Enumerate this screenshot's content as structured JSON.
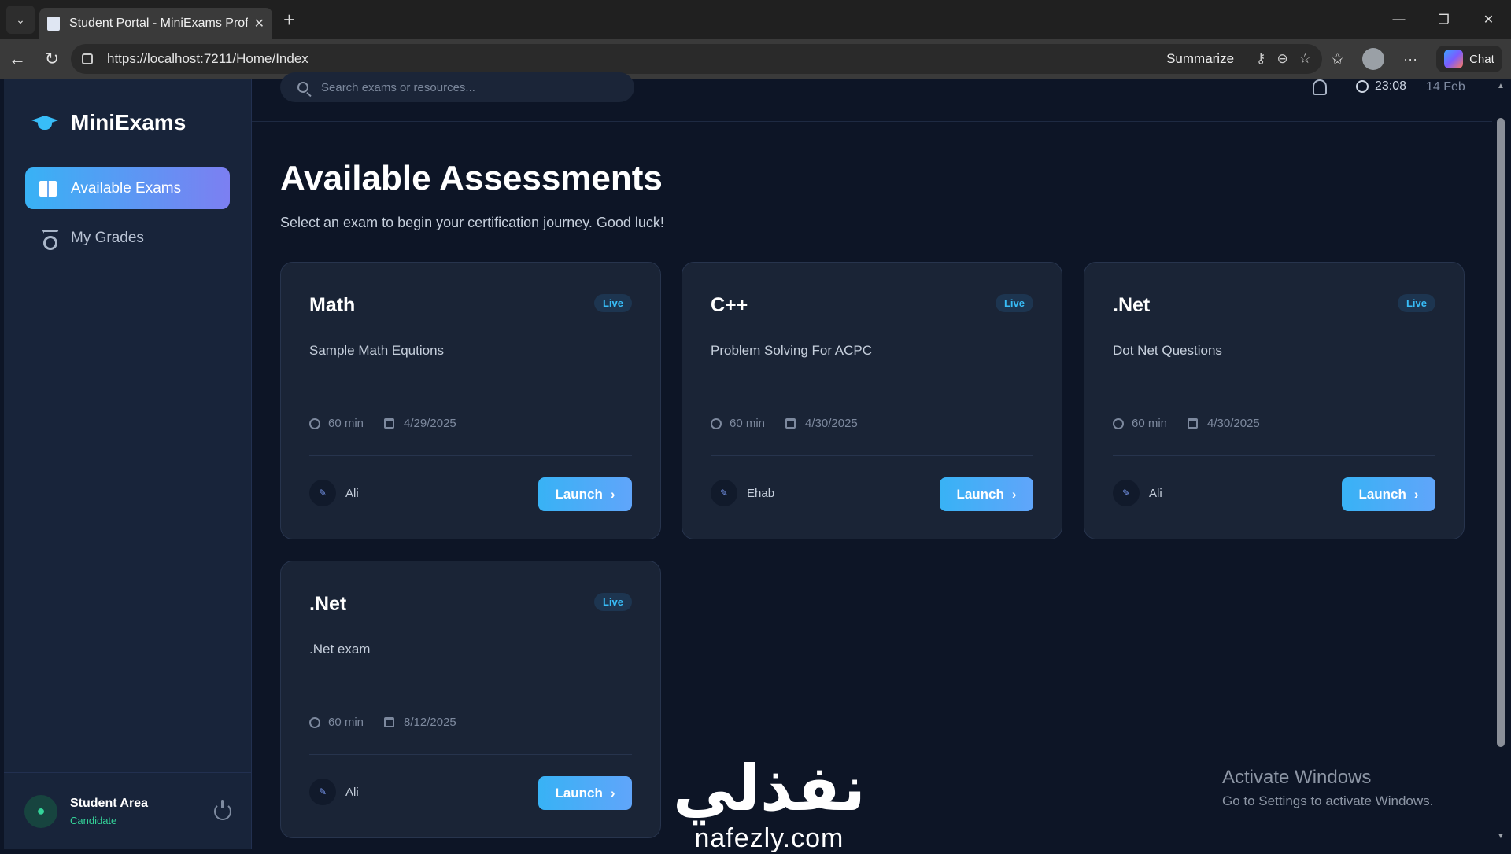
{
  "browser": {
    "tab_title": "Student Portal - MiniExams Profess",
    "url": "https://localhost:7211/Home/Index",
    "summarize_label": "Summarize",
    "chat_label": "Chat"
  },
  "sidebar": {
    "brand": "MiniExams",
    "items": [
      {
        "label": "Available Exams",
        "icon": "book-icon",
        "active": true
      },
      {
        "label": "My Grades",
        "icon": "medal-icon",
        "active": false
      }
    ],
    "user": {
      "name": "Student Area",
      "role": "Candidate"
    }
  },
  "topbar": {
    "search_placeholder": "Search exams or resources...",
    "time": "23:08",
    "date": "14 Feb"
  },
  "main": {
    "title": "Available Assessments",
    "subtitle": "Select an exam to begin your certification journey. Good luck!",
    "cards": [
      {
        "title": "Math",
        "badge": "Live",
        "description": "Sample Math Equtions",
        "duration": "60 min",
        "date": "4/29/2025",
        "author": "Ali",
        "button": "Launch"
      },
      {
        "title": "C++",
        "badge": "Live",
        "description": "Problem Solving For ACPC",
        "duration": "60 min",
        "date": "4/30/2025",
        "author": "Ehab",
        "button": "Launch"
      },
      {
        "title": ".Net",
        "badge": "Live",
        "description": "Dot Net Questions",
        "duration": "60 min",
        "date": "4/30/2025",
        "author": "Ali",
        "button": "Launch"
      },
      {
        "title": ".Net",
        "badge": "Live",
        "description": ".Net exam",
        "duration": "60 min",
        "date": "8/12/2025",
        "author": "Ali",
        "button": "Launch"
      }
    ]
  },
  "overlay": {
    "activate_title": "Activate Windows",
    "activate_sub": "Go to Settings to activate Windows.",
    "watermark_ar": "نفذلي",
    "watermark_en": "nafezly.com"
  },
  "colors": {
    "accent": "#38bdf8",
    "background": "#0d1526",
    "sidebar": "#18243a",
    "card": "#1a2436",
    "success": "#34d399"
  }
}
